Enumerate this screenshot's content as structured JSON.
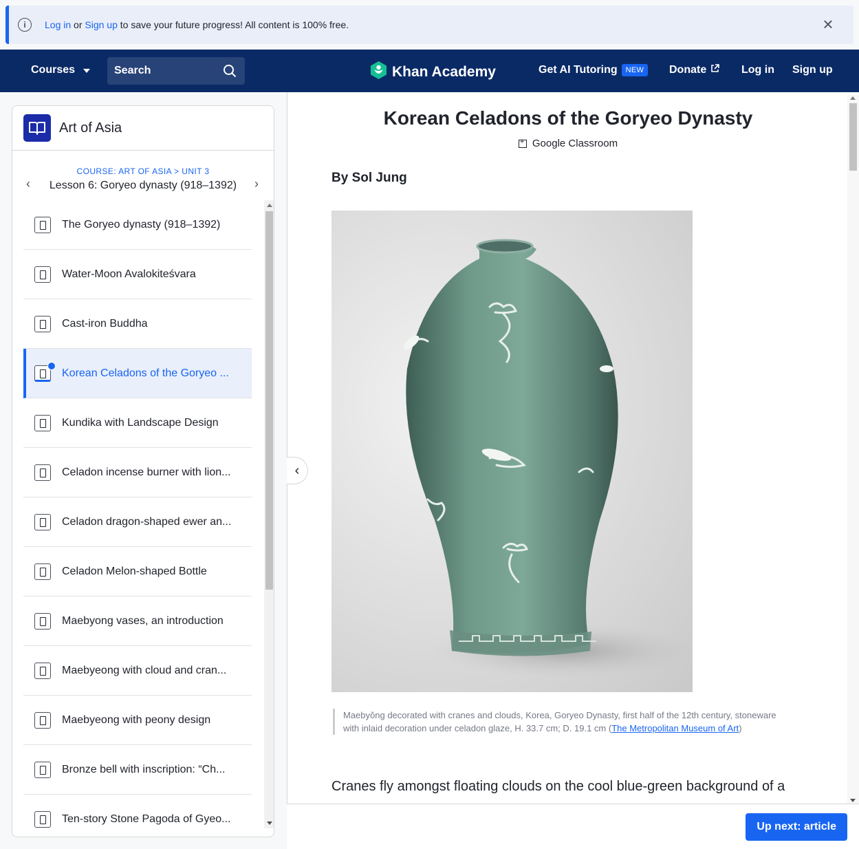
{
  "banner": {
    "login": "Log in",
    "or": " or ",
    "signup": "Sign up",
    "rest": " to save your future progress! All content is 100% free."
  },
  "header": {
    "courses": "Courses",
    "search_label": "Search",
    "logo": "Khan Academy",
    "ai": "Get AI Tutoring",
    "new_badge": "NEW",
    "donate": "Donate",
    "login": "Log in",
    "signup": "Sign up"
  },
  "sidebar": {
    "course_title": "Art of Asia",
    "breadcrumb": "COURSE: ART OF ASIA > UNIT 3",
    "lesson_title": "Lesson 6: Goryeo dynasty (918–1392)",
    "items": [
      {
        "label": "The Goryeo dynasty (918–1392)"
      },
      {
        "label": "Water-Moon Avalokiteśvara"
      },
      {
        "label": "Cast-iron Buddha"
      },
      {
        "label": "Korean Celadons of the Goryeo ..."
      },
      {
        "label": "Kundika with Landscape Design"
      },
      {
        "label": "Celadon incense burner with lion..."
      },
      {
        "label": "Celadon dragon-shaped ewer an..."
      },
      {
        "label": "Celadon Melon-shaped Bottle"
      },
      {
        "label": "Maebyong vases, an introduction"
      },
      {
        "label": "Maebyeong with cloud and cran..."
      },
      {
        "label": "Maebyeong with peony design"
      },
      {
        "label": "Bronze bell with inscription: “Ch..."
      },
      {
        "label": "Ten-story Stone Pagoda of Gyeo..."
      }
    ]
  },
  "article": {
    "title": "Korean Celadons of the Goryeo Dynasty",
    "classroom": "Google Classroom",
    "author": "By Sol Jung",
    "caption_text": "Maebyŏng decorated with cranes and clouds, Korea, Goryeo Dynasty, first half of the 12th century, stoneware with inlaid decoration under celadon glaze, H. 33.7 cm; D. 19.1 cm (",
    "caption_link": "The Metropolitan Museum of Art",
    "caption_end": ")",
    "body_visible": "Cranes fly amongst floating clouds on the cool blue-green background of a"
  },
  "footer": {
    "next_button": "Up next: article"
  },
  "colors": {
    "brand_navy": "#0a2a66",
    "accent_blue": "#1865f2",
    "celadon": "#6f9a8a"
  }
}
